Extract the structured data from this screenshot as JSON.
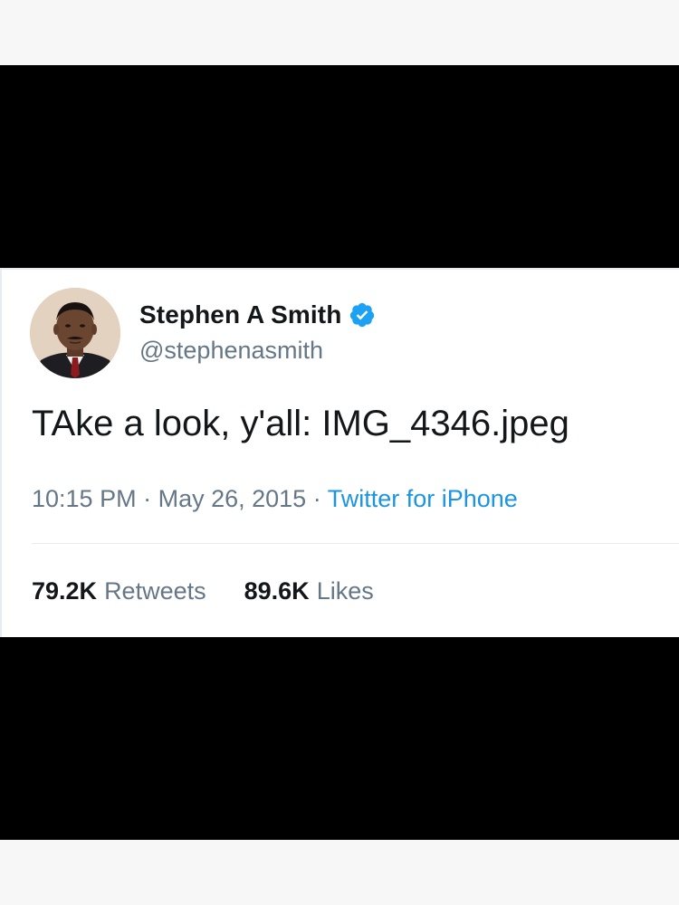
{
  "tweet": {
    "display_name": "Stephen A Smith",
    "handle": "@stephenasmith",
    "verified": true,
    "text": "TAke a look, y'all: IMG_4346.jpeg",
    "time": "10:15 PM",
    "separator": "·",
    "date": "May 26, 2015",
    "source": "Twitter for iPhone",
    "retweets": {
      "count": "79.2K",
      "label": "Retweets"
    },
    "likes": {
      "count": "89.6K",
      "label": "Likes"
    }
  },
  "colors": {
    "verified": "#1da1f2",
    "source_link": "#1b95e0",
    "muted_text": "#657786",
    "primary_text": "#14171a",
    "band": "#000000"
  }
}
